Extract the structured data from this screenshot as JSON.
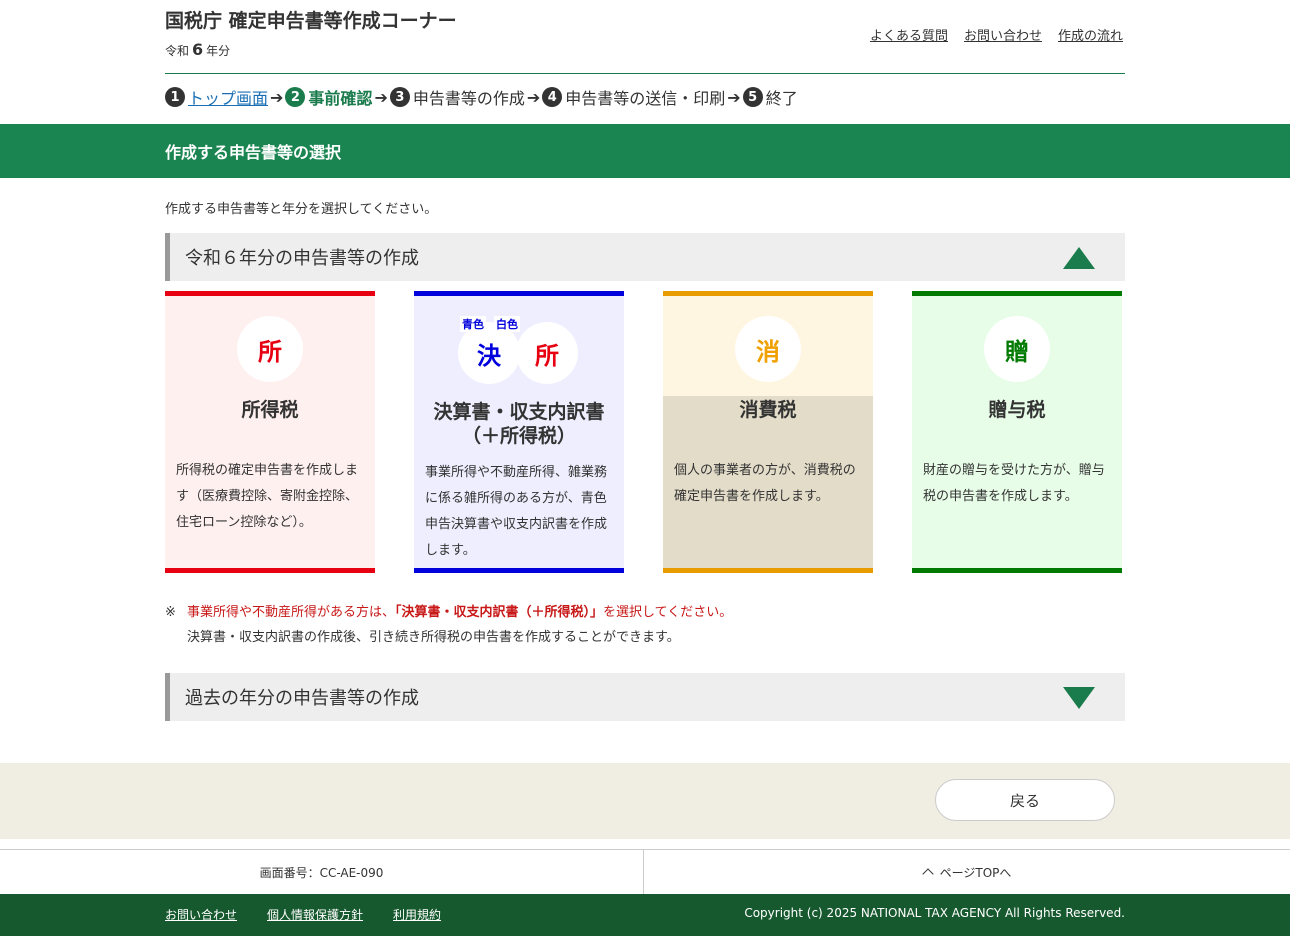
{
  "header": {
    "title": "国税庁 確定申告書等作成コーナー",
    "year_prefix": "令和",
    "year_number": "6",
    "year_suffix": "年分",
    "links": [
      "よくある質問",
      "お問い合わせ",
      "作成の流れ"
    ]
  },
  "steps": [
    {
      "num": "1",
      "label": "トップ画面"
    },
    {
      "num": "2",
      "label": "事前確認"
    },
    {
      "num": "3",
      "label": "申告書等の作成"
    },
    {
      "num": "4",
      "label": "申告書等の送信・印刷"
    },
    {
      "num": "5",
      "label": "終了"
    }
  ],
  "arrow": "➔",
  "page_title": "作成する申告書等の選択",
  "instruction": "作成する申告書等と年分を選択してください。",
  "current_year_section": "令和６年分の申告書等の作成",
  "past_year_section": "過去の年分の申告書等の作成",
  "cards": {
    "income": {
      "icon": "所",
      "title": "所得税",
      "desc": "所得税の確定申告書を作成します（医療費控除、寄附金控除、住宅ローン控除など）。"
    },
    "settlement": {
      "tag_blue": "青色",
      "tag_white": "白色",
      "icon_a": "決",
      "icon_b": "所",
      "title_line1": "決算書・収支内訳書",
      "title_line2": "（＋所得税）",
      "desc": "事業所得や不動産所得、雑業務に係る雑所得のある方が、青色申告決算書や収支内訳書を作成します。"
    },
    "consumption": {
      "icon": "消",
      "title": "消費税",
      "desc": "個人の事業者の方が、消費税の確定申告書を作成します。"
    },
    "gift": {
      "icon": "贈",
      "title": "贈与税",
      "desc": "財産の贈与を受けた方が、贈与税の申告書を作成します。"
    }
  },
  "note": {
    "mark": "※",
    "line1_pre": "事業所得や不動産所得がある方は、",
    "line1_bold": "「決算書・収支内訳書（＋所得税）」",
    "line1_post": "を選択してください。",
    "line2": "決算書・収支内訳書の作成後、引き続き所得税の申告書を作成することができます。"
  },
  "back_button": "戻る",
  "screen_id": "画面番号：CC-AE-090",
  "page_top": "ページTOPへ",
  "footer": {
    "links": [
      "お問い合わせ",
      "個人情報保護方針",
      "利用規約"
    ],
    "copyright": "Copyright (c) 2025 NATIONAL TAX AGENCY All Rights Reserved."
  },
  "colors": {
    "brand_green": "#1a8550",
    "footer_green": "#17592f",
    "income_red": "#e60012",
    "settlement_blue": "#0000dd",
    "consumption_orange": "#e89c00",
    "gift_green": "#007a00"
  }
}
